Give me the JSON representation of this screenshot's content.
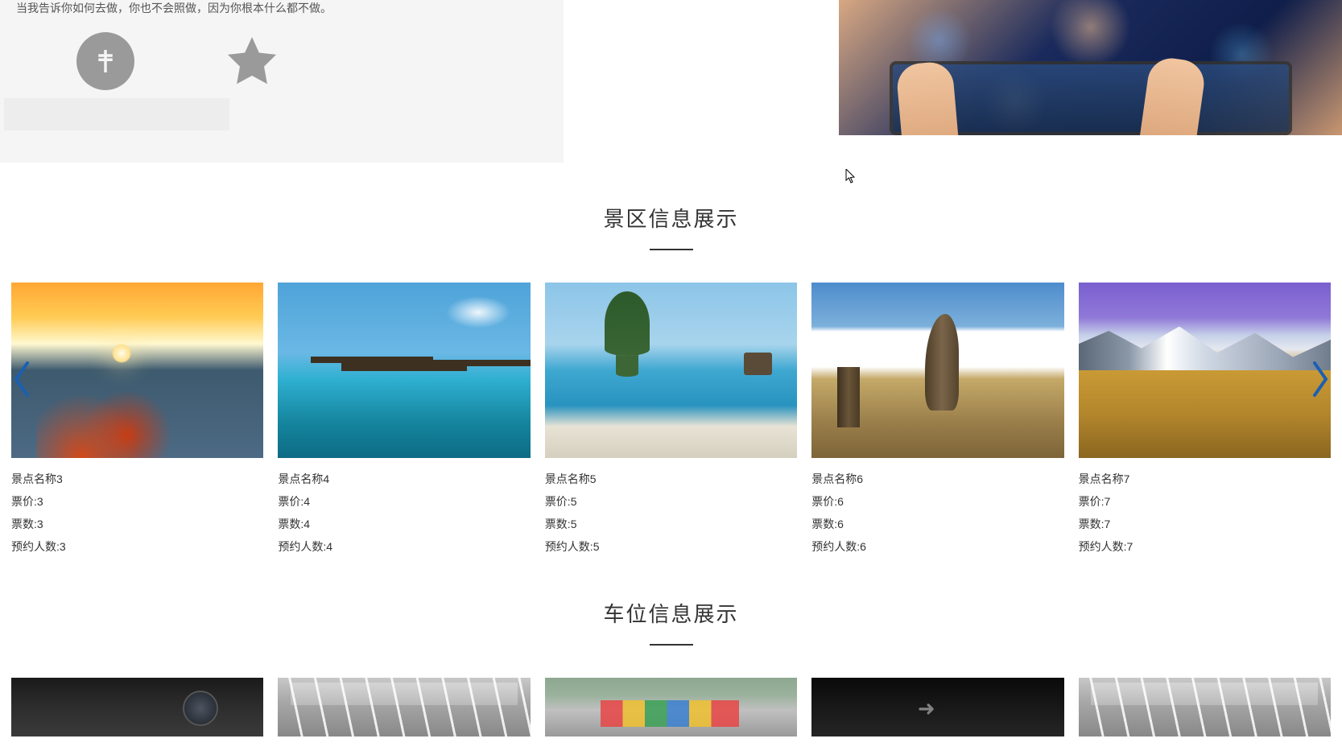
{
  "top": {
    "text": "当我告诉你如何去做，你也不会照做，因为你根本什么都不做。"
  },
  "sections": {
    "scenic_title": "景区信息展示",
    "parking_title": "车位信息展示"
  },
  "labels": {
    "name_prefix": "景点名称",
    "price_prefix": "票价:",
    "count_prefix": "票数:",
    "booked_prefix": "预约人数:"
  },
  "scenic_items": [
    {
      "name": "景点名称3",
      "price": "票价:3",
      "count": "票数:3",
      "booked": "预约人数:3"
    },
    {
      "name": "景点名称4",
      "price": "票价:4",
      "count": "票数:4",
      "booked": "预约人数:4"
    },
    {
      "name": "景点名称5",
      "price": "票价:5",
      "count": "票数:5",
      "booked": "预约人数:5"
    },
    {
      "name": "景点名称6",
      "price": "票价:6",
      "count": "票数:6",
      "booked": "预约人数:6"
    },
    {
      "name": "景点名称7",
      "price": "票价:7",
      "count": "票数:7",
      "booked": "预约人数:7"
    }
  ]
}
